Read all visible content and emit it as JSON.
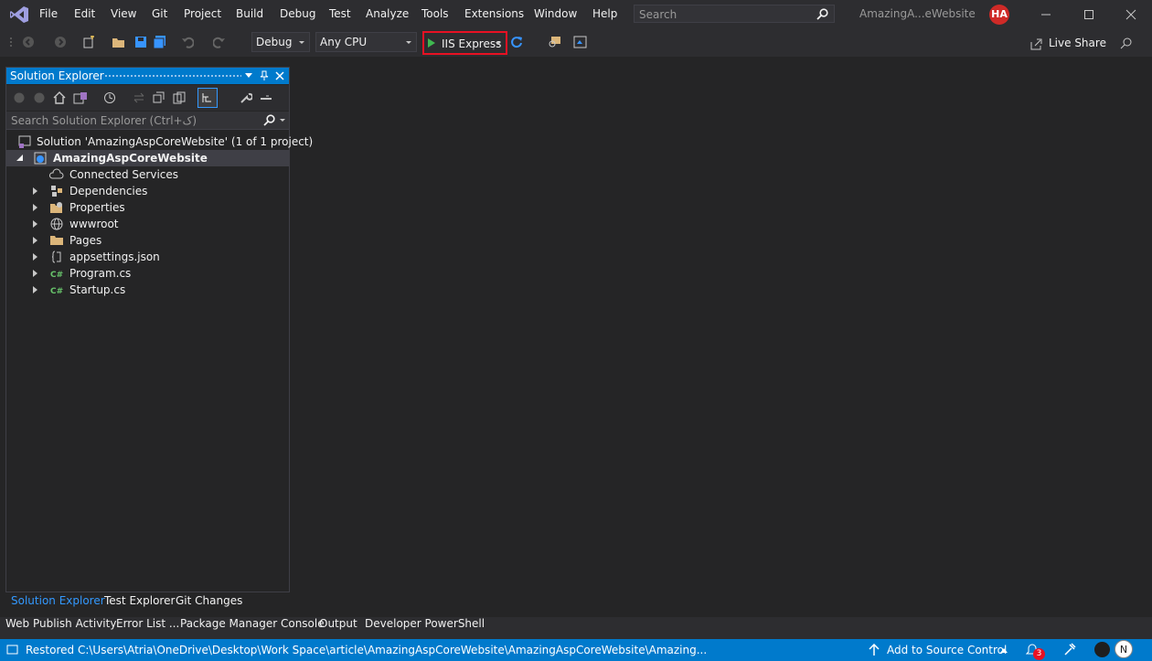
{
  "menu": {
    "items": [
      "File",
      "Edit",
      "View",
      "Git",
      "Project",
      "Build",
      "Debug",
      "Test",
      "Analyze",
      "Tools",
      "Extensions",
      "Window",
      "Help"
    ]
  },
  "search": {
    "placeholder": "Search"
  },
  "window": {
    "title": "AmazingA...eWebsite",
    "avatar_initials": "HA"
  },
  "toolbar": {
    "configuration": "Debug",
    "platform": "Any CPU",
    "run_target": "IIS Express",
    "live_share": "Live Share"
  },
  "solution_explorer": {
    "title": "Solution Explorer",
    "search_placeholder": "Search Solution Explorer (Ctrl+ک)",
    "tree": [
      {
        "label": "Solution 'AmazingAspCoreWebsite' (1 of 1 project)",
        "icon": "solution-icon"
      },
      {
        "label": "AmazingAspCoreWebsite",
        "icon": "web-project-icon",
        "expanded": true,
        "selected": true
      },
      {
        "label": "Connected Services",
        "icon": "connected-services-icon"
      },
      {
        "label": "Dependencies",
        "icon": "dependencies-icon"
      },
      {
        "label": "Properties",
        "icon": "properties-icon"
      },
      {
        "label": "wwwroot",
        "icon": "globe-icon"
      },
      {
        "label": "Pages",
        "icon": "folder-icon"
      },
      {
        "label": "appsettings.json",
        "icon": "json-file-icon"
      },
      {
        "label": "Program.cs",
        "icon": "csharp-file-icon"
      },
      {
        "label": "Startup.cs",
        "icon": "csharp-file-icon"
      }
    ]
  },
  "panel_tabs": [
    "Solution Explorer",
    "Test Explorer",
    "Git Changes"
  ],
  "bottom_tabs": [
    "Web Publish Activity",
    "Error List ...",
    "Package Manager Console",
    "Output",
    "Developer PowerShell"
  ],
  "status": {
    "message": "Restored C:\\Users\\Atria\\OneDrive\\Desktop\\Work Space\\article\\AmazingAspCoreWebsite\\AmazingAspCoreWebsite\\Amazing...",
    "source_control": "Add to Source Control",
    "notification_count": "3",
    "account_initial": "N"
  },
  "colors": {
    "accent": "#007acc",
    "highlight": "#e81123",
    "background": "#252526",
    "chrome": "#2d2d30"
  }
}
